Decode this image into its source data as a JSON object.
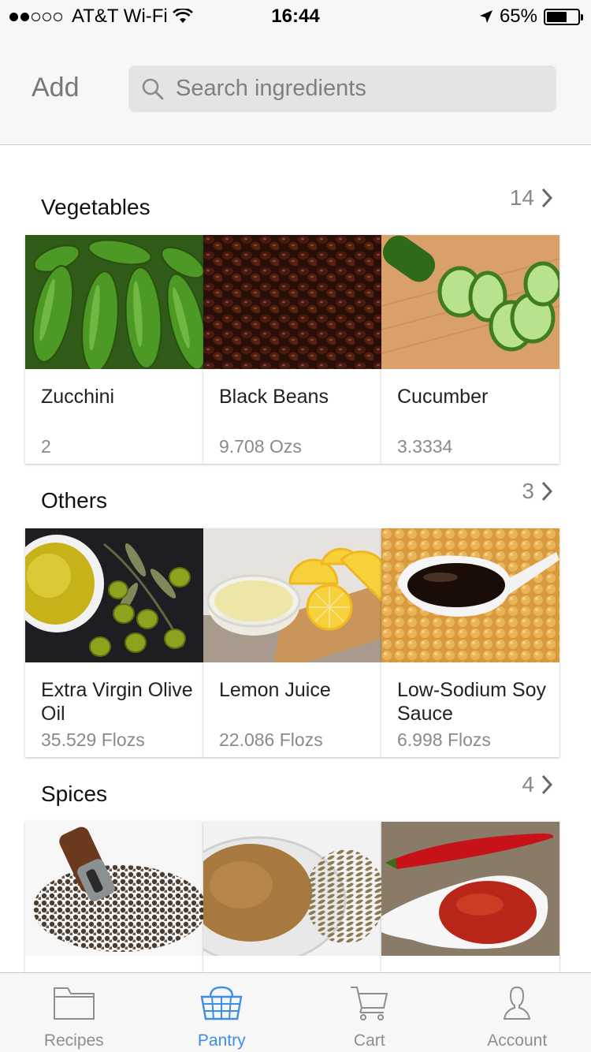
{
  "status_bar": {
    "carrier": "AT&T Wi-Fi",
    "time": "16:44",
    "battery": "65%",
    "battery_level": 0.65
  },
  "header": {
    "add_label": "Add",
    "search_placeholder": "Search ingredients"
  },
  "sections": [
    {
      "title": "Vegetables",
      "count": "14",
      "items": [
        {
          "name": "Zucchini",
          "quantity": "2",
          "image": "zucchini-photo"
        },
        {
          "name": "Black Beans",
          "quantity": "9.708 Ozs",
          "image": "black-beans-photo"
        },
        {
          "name": "Cucumber",
          "quantity": "3.3334",
          "image": "cucumber-photo"
        }
      ]
    },
    {
      "title": "Others",
      "count": "3",
      "items": [
        {
          "name": "Extra Virgin Olive Oil",
          "quantity": "35.529 Flozs",
          "image": "olive-oil-photo"
        },
        {
          "name": "Lemon Juice",
          "quantity": "22.086 Flozs",
          "image": "lemon-juice-photo"
        },
        {
          "name": "Low-Sodium Soy Sauce",
          "quantity": "6.998 Flozs",
          "image": "soy-sauce-photo"
        }
      ]
    },
    {
      "title": "Spices",
      "count": "4",
      "items": [
        {
          "name": "",
          "quantity": "",
          "image": "black-pepper-photo"
        },
        {
          "name": "",
          "quantity": "",
          "image": "cumin-photo"
        },
        {
          "name": "",
          "quantity": "",
          "image": "chili-flakes-photo"
        }
      ]
    }
  ],
  "tab_bar": {
    "tabs": [
      {
        "label": "Recipes",
        "icon": "folder-icon",
        "active": false
      },
      {
        "label": "Pantry",
        "icon": "basket-icon",
        "active": true
      },
      {
        "label": "Cart",
        "icon": "cart-icon",
        "active": false
      },
      {
        "label": "Account",
        "icon": "person-icon",
        "active": false
      }
    ]
  },
  "colors": {
    "accent": "#3d8ee6",
    "inactive": "#8e8e8e",
    "background": "#f7f7f7"
  }
}
